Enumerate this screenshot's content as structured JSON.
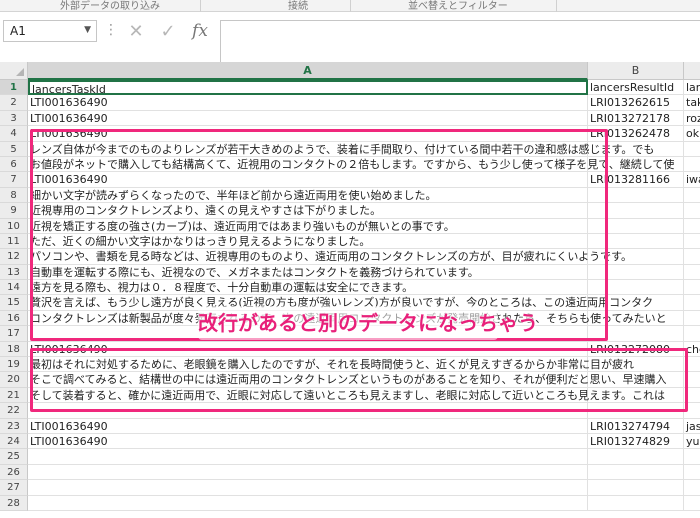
{
  "ribbon": {
    "groups": [
      "外部データの取り込み",
      "接続",
      "並べ替えとフィルター"
    ]
  },
  "formula_bar": {
    "name_box": "A1",
    "cancel_icon": "✕",
    "enter_icon": "✓",
    "fx_label": "fx",
    "value": ""
  },
  "columns": [
    {
      "label": "A"
    },
    {
      "label": "B"
    }
  ],
  "rows": [
    {
      "n": "1",
      "a": "lancersTaskId",
      "b": "lancersResultId",
      "c": "lan"
    },
    {
      "n": "2",
      "a": "LTI001636490",
      "b": "LRI013262615",
      "c": "tak"
    },
    {
      "n": "3",
      "a": "LTI001636490",
      "b": "LRI013272178",
      "c": "roz"
    },
    {
      "n": "4",
      "a": "LTI001636490",
      "b": "LRI013262478",
      "c": "oki"
    },
    {
      "n": "5",
      "a": "レンズ自体が今までのものよりレンズが若干大きめのようで、装着に手間取り、付けている間中若干の違和感は感じます。でも",
      "b": "",
      "c": ""
    },
    {
      "n": "6",
      "a": "お値段がネットで購入しても結構高くて、近視用のコンタクトの２倍もします。ですから、もう少し使って様子を見て、継続して使",
      "b": "",
      "c": ""
    },
    {
      "n": "7",
      "a": "LTI001636490",
      "b": "LRI013281166",
      "c": "iwa"
    },
    {
      "n": "8",
      "a": "細かい文字が読みずらくなったので、半年ほど前から遠近両用を使い始めました。",
      "b": "",
      "c": ""
    },
    {
      "n": "9",
      "a": "近視専用のコンタクトレンズより、遠くの見えやすさは下がりました。",
      "b": "",
      "c": ""
    },
    {
      "n": "10",
      "a": "近視を矯正する度の強さ(カーブ)は、遠近両用ではあまり強いものが無いとの事です。",
      "b": "",
      "c": ""
    },
    {
      "n": "11",
      "a": "ただ、近くの細かい文字はかなりはっきり見えるようになりました。",
      "b": "",
      "c": ""
    },
    {
      "n": "12",
      "a": "パソコンや、書類を見る時などは、近視専用のものより、遠近両用のコンタクトレンズの方が、目が疲れにくいようです。",
      "b": "",
      "c": ""
    },
    {
      "n": "13",
      "a": "自動車を運転する際にも、近視なので、メガネまたはコンタクトを義務づけられています。",
      "b": "",
      "c": ""
    },
    {
      "n": "14",
      "a": "遠方を見る際も、視力は０．８程度で、十分自動車の運転は安全にできます。",
      "b": "",
      "c": ""
    },
    {
      "n": "15",
      "a": "贅沢を言えば、もう少し遠方が良く見える(近視の方も度が強いレンズ)方が良いですが、今のところは、この遠近両用コンタク",
      "b": "",
      "c": ""
    },
    {
      "n": "16",
      "a": "コンタクトレンズは新製品が度々発売されるので、次の遠近両用コンタクトレンズが発売開始されたら、そちらも使ってみたいと",
      "b": "",
      "c": ""
    },
    {
      "n": "17",
      "a": "",
      "b": "",
      "c": ""
    },
    {
      "n": "18",
      "a": "LTI001636490",
      "b": "LRI013272080",
      "c": "che"
    },
    {
      "n": "19",
      "a": "最初はそれに対処するために、老眼鏡を購入したのですが、それを長時間使うと、近くが見えすぎるからか非常に目が疲れ",
      "b": "",
      "c": ""
    },
    {
      "n": "20",
      "a": "そこで調べてみると、結構世の中には遠近両用のコンタクトレンズというものがあることを知り、それが便利だと思い、早速購入",
      "b": "",
      "c": ""
    },
    {
      "n": "21",
      "a": "そして装着すると、確かに遠近両用で、近眼に対応して遠いところも見えますし、老眼に対応して近いところも見えます。これは",
      "b": "",
      "c": ""
    },
    {
      "n": "22",
      "a": "",
      "b": "",
      "c": ""
    },
    {
      "n": "23",
      "a": "LTI001636490",
      "b": "LRI013274794",
      "c": "jas"
    },
    {
      "n": "24",
      "a": "LTI001636490",
      "b": "LRI013274829",
      "c": "yuc"
    },
    {
      "n": "25",
      "a": "",
      "b": "",
      "c": ""
    },
    {
      "n": "26",
      "a": "",
      "b": "",
      "c": ""
    },
    {
      "n": "27",
      "a": "",
      "b": "",
      "c": ""
    },
    {
      "n": "28",
      "a": "",
      "b": "",
      "c": ""
    }
  ],
  "annotation": {
    "callout": "改行があると別のデータになっちゃう",
    "accent": "#f0287c"
  }
}
